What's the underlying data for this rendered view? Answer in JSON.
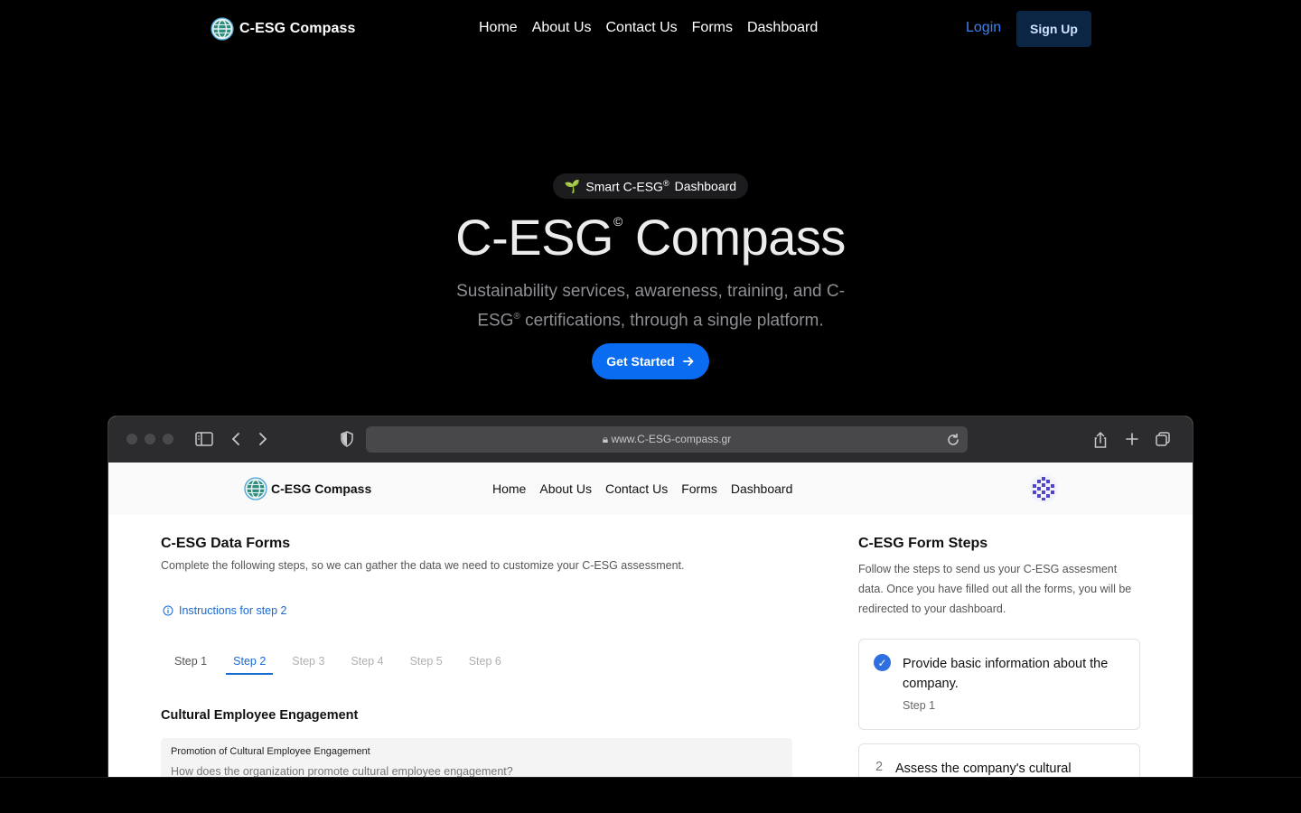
{
  "header": {
    "brand": "C-ESG Compass",
    "logo_icon": "globe-logo-icon",
    "nav": [
      "Home",
      "About Us",
      "Contact Us",
      "Forms",
      "Dashboard"
    ],
    "login": "Login",
    "signup": "Sign Up"
  },
  "hero": {
    "badge_emoji": "🌱",
    "badge_text": "Smart C-ESG",
    "badge_reg": "®",
    "badge_suffix": "Dashboard",
    "title_left": "C-ESG",
    "title_reg": "©",
    "title_right": "Compass",
    "subtitle_1": "Sustainability services, awareness, training, and C-ESG",
    "subtitle_reg": "®",
    "subtitle_2": " certifications, through a single platform.",
    "cta": "Get Started",
    "cta_icon": "arrow-right-icon"
  },
  "browser": {
    "url": "www.C-ESG-compass.gr",
    "app": {
      "brand": "C-ESG Compass",
      "nav": [
        "Home",
        "About Us",
        "Contact Us",
        "Forms",
        "Dashboard"
      ],
      "form": {
        "title": "C-ESG Data Forms",
        "description": "Complete the following steps, so we can gather the data we need to customize your C-ESG assessment.",
        "instructions_link": "Instructions for step 2",
        "tabs": [
          "Step 1",
          "Step 2",
          "Step 3",
          "Step 4",
          "Step 5",
          "Step 6"
        ],
        "active_tab": "Step 2",
        "section_heading": "Cultural Employee Engagement",
        "question_label": "Promotion of Cultural Employee Engagement",
        "question_placeholder": "How does the organization promote cultural employee engagement?"
      },
      "steps_panel": {
        "title": "C-ESG Form Steps",
        "description": "Follow the steps to send us your C-ESG assesment data. Once you have filled out all the forms, you will be redirected to your dashboard.",
        "steps": [
          {
            "number": "1",
            "text": "Provide basic information about the company.",
            "label": "Step 1",
            "status": "complete"
          },
          {
            "number": "2",
            "text": "Assess the company's cultural",
            "status": "current"
          }
        ]
      }
    }
  },
  "colors": {
    "accent_blue": "#0a6cf0",
    "link_blue": "#1769d3",
    "signup_bg": "#0b2545",
    "background": "#000000"
  }
}
